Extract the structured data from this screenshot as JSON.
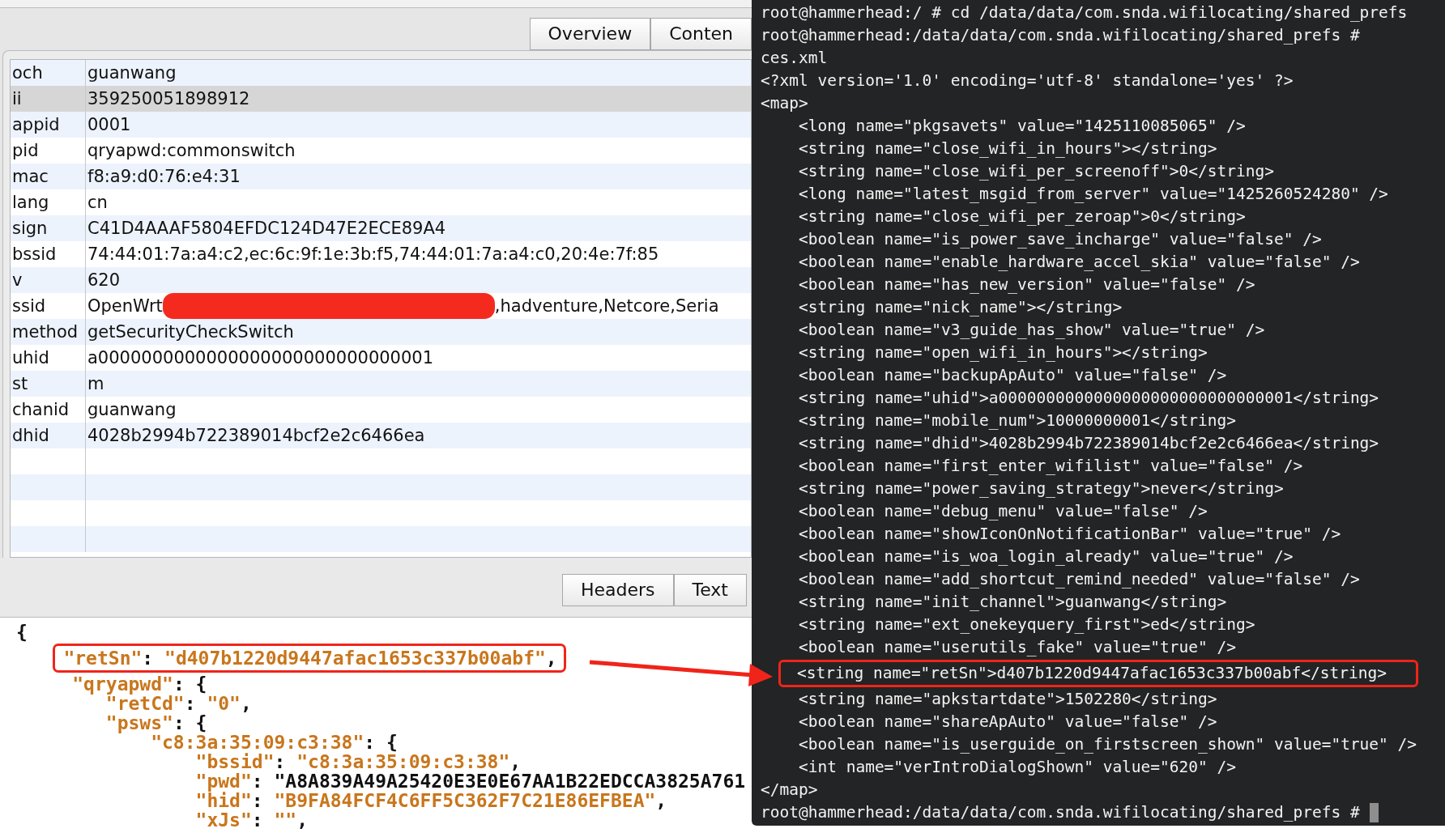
{
  "request_tabs": [
    {
      "label": "Overview",
      "selected": false
    },
    {
      "label": "Conten",
      "selected": false
    }
  ],
  "params": [
    {
      "key": "och",
      "value": "guanwang",
      "selected": false,
      "redacted": false
    },
    {
      "key": "ii",
      "value": "359250051898912",
      "selected": true,
      "redacted": false
    },
    {
      "key": "appid",
      "value": "0001",
      "selected": false,
      "redacted": false
    },
    {
      "key": "pid",
      "value": "qryapwd:commonswitch",
      "selected": false,
      "redacted": false
    },
    {
      "key": "mac",
      "value": "f8:a9:d0:76:e4:31",
      "selected": false,
      "redacted": false
    },
    {
      "key": "lang",
      "value": "cn",
      "selected": false,
      "redacted": false
    },
    {
      "key": "sign",
      "value": "C41D4AAAF5804EFDC124D47E2ECE89A4",
      "selected": false,
      "redacted": false
    },
    {
      "key": "bssid",
      "value": "74:44:01:7a:a4:c2,ec:6c:9f:1e:3b:f5,74:44:01:7a:a4:c0,20:4e:7f:85",
      "selected": false,
      "redacted": false
    },
    {
      "key": "v",
      "value": "620",
      "selected": false,
      "redacted": false
    },
    {
      "key": "ssid",
      "value": "OpenWrt",
      "redacted": true,
      "value_after": ",hadventure,Netcore,Seria",
      "selected": false
    },
    {
      "key": "method",
      "value": "getSecurityCheckSwitch",
      "selected": false,
      "redacted": false
    },
    {
      "key": "uhid",
      "value": "a0000000000000000000000000000001",
      "selected": false,
      "redacted": false
    },
    {
      "key": "st",
      "value": "m",
      "selected": false,
      "redacted": false
    },
    {
      "key": "chanid",
      "value": "guanwang",
      "selected": false,
      "redacted": false
    },
    {
      "key": "dhid",
      "value": "4028b2994b722389014bcf2e2c6466ea",
      "selected": false,
      "redacted": false
    }
  ],
  "response_tabs": [
    {
      "label": "Headers",
      "selected": false
    },
    {
      "label": "Text",
      "selected": false
    }
  ],
  "response_body": [
    {
      "text": "{",
      "highlighted": false
    },
    {
      "text": "    \"retSn\": \"d407b1220d9447afac1653c337b00abf\",",
      "highlighted": true
    },
    {
      "text": "     \"qryapwd\": {",
      "highlighted": false
    },
    {
      "text": "        \"retCd\": \"0\",",
      "highlighted": false
    },
    {
      "text": "        \"psws\": {",
      "highlighted": false
    },
    {
      "text": "            \"c8:3a:35:09:c3:38\": {",
      "highlighted": false
    },
    {
      "text": "                \"bssid\": \"c8:3a:35:09:c3:38\",",
      "highlighted": false
    },
    {
      "text": "                \"pwd\": \"A8A839A49A25420E3E0E67AA1B22EDCCA3825A761",
      "highlighted": false
    },
    {
      "text": "                \"hid\": \"B9FA84FCF4C6FF5C362F7C21E86EFBEA\",",
      "highlighted": false
    },
    {
      "text": "                \"xJs\": \"\",",
      "highlighted": false
    }
  ],
  "terminal": {
    "cursor": true,
    "lines": [
      {
        "text": "root@hammerhead:/ # cd /data/data/com.snda.wifilocating/shared_prefs",
        "highlighted": false
      },
      {
        "text": "root@hammerhead:/data/data/com.snda.wifilocating/shared_prefs #",
        "highlighted": false
      },
      {
        "text": "ces.xml",
        "highlighted": false
      },
      {
        "text": "<?xml version='1.0' encoding='utf-8' standalone='yes' ?>",
        "highlighted": false
      },
      {
        "text": "<map>",
        "highlighted": false
      },
      {
        "text": "    <long name=\"pkgsavets\" value=\"1425110085065\" />",
        "highlighted": false
      },
      {
        "text": "    <string name=\"close_wifi_in_hours\"></string>",
        "highlighted": false
      },
      {
        "text": "    <string name=\"close_wifi_per_screenoff\">0</string>",
        "highlighted": false
      },
      {
        "text": "    <long name=\"latest_msgid_from_server\" value=\"1425260524280\" />",
        "highlighted": false
      },
      {
        "text": "    <string name=\"close_wifi_per_zeroap\">0</string>",
        "highlighted": false
      },
      {
        "text": "    <boolean name=\"is_power_save_incharge\" value=\"false\" />",
        "highlighted": false
      },
      {
        "text": "    <boolean name=\"enable_hardware_accel_skia\" value=\"false\" />",
        "highlighted": false
      },
      {
        "text": "    <boolean name=\"has_new_version\" value=\"false\" />",
        "highlighted": false
      },
      {
        "text": "    <string name=\"nick_name\"></string>",
        "highlighted": false
      },
      {
        "text": "    <boolean name=\"v3_guide_has_show\" value=\"true\" />",
        "highlighted": false
      },
      {
        "text": "    <string name=\"open_wifi_in_hours\"></string>",
        "highlighted": false
      },
      {
        "text": "    <boolean name=\"backupApAuto\" value=\"false\" />",
        "highlighted": false
      },
      {
        "text": "    <string name=\"uhid\">a0000000000000000000000000000001</string>",
        "highlighted": false
      },
      {
        "text": "    <string name=\"mobile_num\">10000000001</string>",
        "highlighted": false
      },
      {
        "text": "    <string name=\"dhid\">4028b2994b722389014bcf2e2c6466ea</string>",
        "highlighted": false
      },
      {
        "text": "    <boolean name=\"first_enter_wifilist\" value=\"false\" />",
        "highlighted": false
      },
      {
        "text": "    <string name=\"power_saving_strategy\">never</string>",
        "highlighted": false
      },
      {
        "text": "    <boolean name=\"debug_menu\" value=\"false\" />",
        "highlighted": false
      },
      {
        "text": "    <boolean name=\"showIconOnNotificationBar\" value=\"true\" />",
        "highlighted": false
      },
      {
        "text": "    <boolean name=\"is_woa_login_already\" value=\"true\" />",
        "highlighted": false
      },
      {
        "text": "    <boolean name=\"add_shortcut_remind_needed\" value=\"false\" />",
        "highlighted": false
      },
      {
        "text": "    <string name=\"init_channel\">guanwang</string>",
        "highlighted": false
      },
      {
        "text": "    <string name=\"ext_onekeyquery_first\">ed</string>",
        "highlighted": false
      },
      {
        "text": "    <boolean name=\"userutils_fake\" value=\"true\" />",
        "highlighted": false
      },
      {
        "text": "    <string name=\"retSn\">d407b1220d9447afac1653c337b00abf</string>",
        "highlighted": true
      },
      {
        "text": "    <string name=\"apkstartdate\">1502280</string>",
        "highlighted": false
      },
      {
        "text": "    <boolean name=\"shareApAuto\" value=\"false\" />",
        "highlighted": false
      },
      {
        "text": "    <boolean name=\"is_userguide_on_firstscreen_shown\" value=\"true\" />",
        "highlighted": false
      },
      {
        "text": "    <int name=\"verIntroDialogShown\" value=\"620\" />",
        "highlighted": false
      },
      {
        "text": "</map>",
        "highlighted": false
      },
      {
        "text": "root@hammerhead:/data/data/com.snda.wifilocating/shared_prefs #",
        "highlighted": false
      }
    ]
  },
  "annotation": {
    "arrow": true
  }
}
